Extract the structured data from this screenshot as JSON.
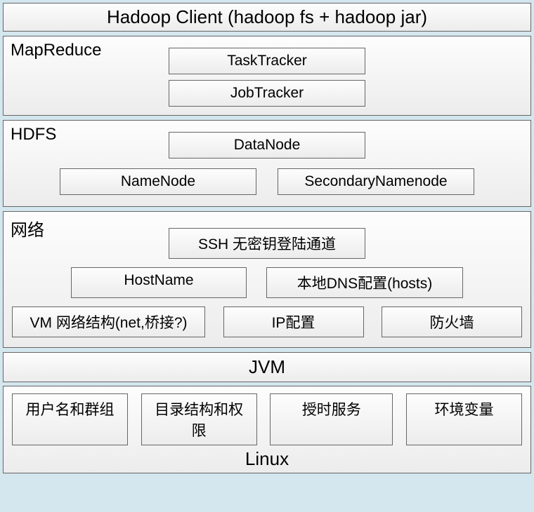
{
  "header": {
    "title": "Hadoop Client (hadoop fs + hadoop jar)"
  },
  "mapreduce": {
    "label": "MapReduce",
    "boxes": [
      "TaskTracker",
      "JobTracker"
    ]
  },
  "hdfs": {
    "label": "HDFS",
    "top": "DataNode",
    "bottom": [
      "NameNode",
      "SecondaryNamenode"
    ]
  },
  "network": {
    "label": "网络",
    "row1": [
      "SSH 无密钥登陆通道"
    ],
    "row2": [
      "HostName",
      "本地DNS配置(hosts)"
    ],
    "row3": [
      "VM 网络结构(net,桥接?)",
      "IP配置",
      "防火墙"
    ]
  },
  "jvm": {
    "label": "JVM"
  },
  "linux": {
    "boxes": [
      "用户名和群组",
      "目录结构和权限",
      "授时服务",
      "环境变量"
    ],
    "label": "Linux"
  }
}
